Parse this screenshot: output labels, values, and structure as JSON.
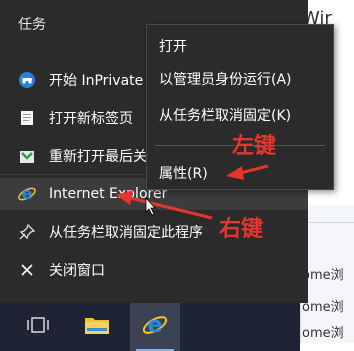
{
  "background": {
    "title_fragment": "Wir",
    "rows": [
      "ome浏",
      "ome浏",
      "ome浏"
    ]
  },
  "jumplist": {
    "header": "任务",
    "items": [
      {
        "label": "开始 InPrivate 浏览",
        "icon": "inprivate-icon"
      },
      {
        "label": "打开新标签页",
        "icon": "new-tab-icon"
      },
      {
        "label": "重新打开最后关闭的会话",
        "icon": "reopen-session-icon"
      },
      {
        "label": "Internet Explorer",
        "icon": "ie-icon"
      },
      {
        "label": "从任务栏取消固定此程序",
        "icon": "unpin-icon"
      },
      {
        "label": "关闭窗口",
        "icon": "close-icon"
      }
    ]
  },
  "context_menu": {
    "items": [
      "打开",
      "以管理员身份运行(A)",
      "从任务栏取消固定(K)",
      "属性(R)"
    ]
  },
  "taskbar": {
    "buttons": [
      {
        "name": "task-view",
        "icon": "task-view-icon"
      },
      {
        "name": "file-explorer",
        "icon": "folder-icon"
      },
      {
        "name": "internet-explorer",
        "icon": "ie-icon"
      }
    ]
  },
  "annotations": {
    "left_click": "左键",
    "right_click": "右键"
  },
  "colors": {
    "menu_bg": "#2b2b2b",
    "taskbar_bg": "#1e2433",
    "annotation": "#e8342e",
    "ie_blue": "#1f8ce0"
  }
}
